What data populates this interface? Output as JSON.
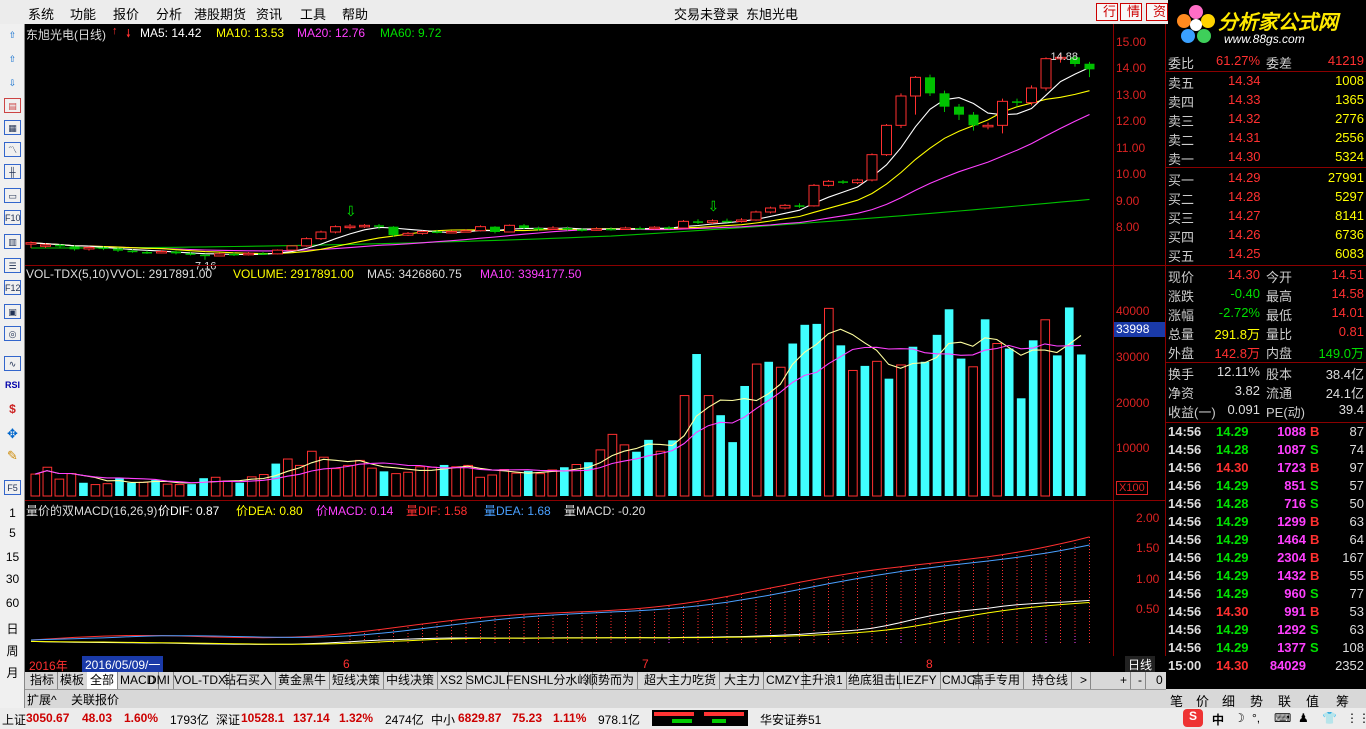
{
  "menu": {
    "items": [
      "系统",
      "功能",
      "报价",
      "分析",
      "港股期货",
      "资讯",
      "工具",
      "帮助"
    ],
    "login_status": "交易未登录",
    "stock_name": "东旭光电",
    "btn_quote": "行",
    "btn_info": "情",
    "btn_more": "资"
  },
  "logo": {
    "title": "分析家公式网",
    "url": "www.88gs.com"
  },
  "toolbar": {
    "period_labels": [
      "1",
      "5",
      "15",
      "30",
      "60",
      "日",
      "周",
      "月"
    ]
  },
  "kline": {
    "title": "东旭光电(日线)",
    "ma5": "MA5: 14.42",
    "ma10": "MA10: 13.53",
    "ma20": "MA20: 12.76",
    "ma60": "MA60: 9.72",
    "high_label": "14.88",
    "low_label": "7.16"
  },
  "volume": {
    "title": "VOL-TDX(5,10)",
    "vvol": "VVOL: 2917891.00",
    "volume": "VOLUME: 2917891.00",
    "ma5": "MA5: 3426860.75",
    "ma10": "MA10: 3394177.50",
    "marker": "33998",
    "scale": "X100"
  },
  "macd": {
    "title": "量价的双MACD(16,26,9)",
    "dif": "价DIF: 0.87",
    "dea": "价DEA: 0.80",
    "macd": "价MACD: 0.14",
    "vdif": "量DIF: 1.58",
    "vdea": "量DEA: 1.68",
    "vmacd": "量MACD: -0.20"
  },
  "axis": {
    "price": [
      "15.00",
      "14.00",
      "13.00",
      "12.00",
      "11.00",
      "10.00",
      "9.00",
      "8.00"
    ],
    "volume": [
      "40000",
      "30000",
      "20000",
      "10000"
    ],
    "macd": [
      "2.00",
      "1.50",
      "1.00",
      "0.50"
    ],
    "period": "日线"
  },
  "timeline": {
    "year": "2016年",
    "date": "2016/05/09/一",
    "months": [
      "6",
      "7",
      "8"
    ]
  },
  "tabs": [
    "指标",
    "模板",
    "全部",
    "MACD",
    "DMI",
    "VOL-TDX",
    "钻石买入",
    "黄金黑牛",
    "短线决策",
    "中线决策",
    "XS2",
    "SMCJL",
    "FENSHL分水岭",
    "顺势而为",
    "超大主力吃货",
    "大主力",
    "CMZY",
    "主升浪1",
    "绝底狙击",
    "LIEZFY",
    "CMJC",
    "高手专用",
    "持仓线",
    ">"
  ],
  "ext_tabs": [
    "扩展^",
    "关联报价"
  ],
  "quote": {
    "top": {
      "wb_label": "委比",
      "wb": "61.27%",
      "wc_label": "委差",
      "wc": "41219"
    },
    "sells": [
      {
        "label": "卖五",
        "price": "14.34",
        "vol": "1008"
      },
      {
        "label": "卖四",
        "price": "14.33",
        "vol": "1365"
      },
      {
        "label": "卖三",
        "price": "14.32",
        "vol": "2776"
      },
      {
        "label": "卖二",
        "price": "14.31",
        "vol": "2556"
      },
      {
        "label": "卖一",
        "price": "14.30",
        "vol": "5324"
      }
    ],
    "buys": [
      {
        "label": "买一",
        "price": "14.29",
        "vol": "27991"
      },
      {
        "label": "买二",
        "price": "14.28",
        "vol": "5297"
      },
      {
        "label": "买三",
        "price": "14.27",
        "vol": "8141"
      },
      {
        "label": "买四",
        "price": "14.26",
        "vol": "6736"
      },
      {
        "label": "买五",
        "price": "14.25",
        "vol": "6083"
      }
    ],
    "stats": [
      {
        "l1": "现价",
        "v1": "14.30",
        "l2": "今开",
        "v2": "14.51"
      },
      {
        "l1": "涨跌",
        "v1": "-0.40",
        "l2": "最高",
        "v2": "14.58"
      },
      {
        "l1": "涨幅",
        "v1": "-2.72%",
        "l2": "最低",
        "v2": "14.01"
      },
      {
        "l1": "总量",
        "v1": "291.8万",
        "l2": "量比",
        "v2": "0.81"
      },
      {
        "l1": "外盘",
        "v1": "142.8万",
        "l2": "内盘",
        "v2": "149.0万"
      }
    ],
    "stats2": [
      {
        "l1": "换手",
        "v1": "12.11%",
        "l2": "股本",
        "v2": "38.4亿"
      },
      {
        "l1": "净资",
        "v1": "3.82",
        "l2": "流通",
        "v2": "24.1亿"
      },
      {
        "l1": "收益(一)",
        "v1": "0.091",
        "l2": "PE(动)",
        "v2": "39.4"
      }
    ],
    "ticks": [
      {
        "t": "14:56",
        "p": "14.29",
        "v": "1088",
        "bs": "B",
        "n": "87"
      },
      {
        "t": "14:56",
        "p": "14.28",
        "v": "1087",
        "bs": "S",
        "n": "74"
      },
      {
        "t": "14:56",
        "p": "14.30",
        "v": "1723",
        "bs": "B",
        "n": "97"
      },
      {
        "t": "14:56",
        "p": "14.29",
        "v": "851",
        "bs": "S",
        "n": "57"
      },
      {
        "t": "14:56",
        "p": "14.28",
        "v": "716",
        "bs": "S",
        "n": "50"
      },
      {
        "t": "14:56",
        "p": "14.29",
        "v": "1299",
        "bs": "B",
        "n": "63"
      },
      {
        "t": "14:56",
        "p": "14.29",
        "v": "1464",
        "bs": "B",
        "n": "64"
      },
      {
        "t": "14:56",
        "p": "14.29",
        "v": "2304",
        "bs": "B",
        "n": "167"
      },
      {
        "t": "14:56",
        "p": "14.29",
        "v": "1432",
        "bs": "B",
        "n": "55"
      },
      {
        "t": "14:56",
        "p": "14.29",
        "v": "960",
        "bs": "S",
        "n": "77"
      },
      {
        "t": "14:56",
        "p": "14.30",
        "v": "991",
        "bs": "B",
        "n": "53"
      },
      {
        "t": "14:56",
        "p": "14.29",
        "v": "1292",
        "bs": "S",
        "n": "63"
      },
      {
        "t": "14:56",
        "p": "14.29",
        "v": "1377",
        "bs": "S",
        "n": "108"
      },
      {
        "t": "15:00",
        "p": "14.30",
        "v": "84029",
        "bs": "",
        "n": "2352"
      }
    ],
    "code_hint": "000413"
  },
  "right_tabs": [
    "笔",
    "价",
    "细",
    "势",
    "联",
    "值",
    "筹"
  ],
  "status": {
    "sh_label": "上证",
    "sh": "3050.67",
    "sh_chg": "48.03",
    "sh_pct": "1.60%",
    "sh_amt": "1793亿",
    "sz_label": "深证",
    "sz": "10528.1",
    "sz_chg": "137.14",
    "sz_pct": "1.32%",
    "sz_amt": "2474亿",
    "zx_label": "中小",
    "zx": "6829.87",
    "zx_chg": "75.23",
    "zx_pct": "1.11%",
    "zx_amt": "978.1亿",
    "broker": "华安证券51",
    "ime": "中"
  },
  "chart_data": {
    "type": "candlestick",
    "price_ylim": [
      7.0,
      15.4
    ],
    "candles": [
      [
        7.75,
        7.8,
        7.6,
        7.85
      ],
      [
        7.7,
        7.72,
        7.6,
        7.78
      ],
      [
        7.72,
        7.66,
        7.62,
        7.75
      ],
      [
        7.66,
        7.55,
        7.5,
        7.7
      ],
      [
        7.6,
        7.62,
        7.5,
        7.66
      ],
      [
        7.62,
        7.58,
        7.52,
        7.66
      ],
      [
        7.58,
        7.5,
        7.45,
        7.62
      ],
      [
        7.5,
        7.45,
        7.42,
        7.55
      ],
      [
        7.45,
        7.42,
        7.38,
        7.5
      ],
      [
        7.42,
        7.47,
        7.4,
        7.52
      ],
      [
        7.47,
        7.4,
        7.36,
        7.5
      ],
      [
        7.4,
        7.35,
        7.32,
        7.45
      ],
      [
        7.35,
        7.3,
        7.16,
        7.38
      ],
      [
        7.3,
        7.38,
        7.28,
        7.42
      ],
      [
        7.38,
        7.35,
        7.3,
        7.45
      ],
      [
        7.35,
        7.4,
        7.32,
        7.45
      ],
      [
        7.4,
        7.38,
        7.34,
        7.45
      ],
      [
        7.38,
        7.52,
        7.36,
        7.55
      ],
      [
        7.52,
        7.68,
        7.5,
        7.7
      ],
      [
        7.68,
        7.95,
        7.65,
        8.0
      ],
      [
        7.95,
        8.2,
        7.9,
        8.25
      ],
      [
        8.2,
        8.4,
        8.15,
        8.45
      ],
      [
        8.4,
        8.42,
        8.3,
        8.5
      ],
      [
        8.42,
        8.45,
        8.35,
        8.5
      ],
      [
        8.45,
        8.4,
        8.3,
        8.5
      ],
      [
        8.4,
        8.08,
        8.02,
        8.42
      ],
      [
        8.08,
        8.15,
        8.05,
        8.2
      ],
      [
        8.15,
        8.22,
        8.1,
        8.25
      ],
      [
        8.22,
        8.2,
        8.15,
        8.28
      ],
      [
        8.2,
        8.22,
        8.15,
        8.25
      ],
      [
        8.22,
        8.25,
        8.18,
        8.3
      ],
      [
        8.25,
        8.4,
        8.22,
        8.45
      ],
      [
        8.4,
        8.2,
        8.15,
        8.42
      ],
      [
        8.2,
        8.45,
        8.18,
        8.48
      ],
      [
        8.45,
        8.35,
        8.3,
        8.5
      ],
      [
        8.35,
        8.3,
        8.25,
        8.4
      ],
      [
        8.3,
        8.35,
        8.28,
        8.42
      ],
      [
        8.35,
        8.3,
        8.25,
        8.4
      ],
      [
        8.3,
        8.28,
        8.22,
        8.35
      ],
      [
        8.28,
        8.32,
        8.25,
        8.38
      ],
      [
        8.32,
        8.3,
        8.25,
        8.38
      ],
      [
        8.3,
        8.35,
        8.28,
        8.4
      ],
      [
        8.35,
        8.33,
        8.28,
        8.4
      ],
      [
        8.33,
        8.38,
        8.3,
        8.42
      ],
      [
        8.38,
        8.35,
        8.3,
        8.42
      ],
      [
        8.35,
        8.6,
        8.33,
        8.65
      ],
      [
        8.6,
        8.55,
        8.5,
        8.68
      ],
      [
        8.55,
        8.62,
        8.5,
        8.68
      ],
      [
        8.62,
        8.6,
        8.55,
        8.7
      ],
      [
        8.6,
        8.65,
        8.55,
        8.72
      ],
      [
        8.65,
        8.95,
        8.62,
        9.0
      ],
      [
        8.95,
        9.1,
        8.9,
        9.15
      ],
      [
        9.1,
        9.2,
        9.05,
        9.25
      ],
      [
        9.2,
        9.18,
        9.1,
        9.28
      ],
      [
        9.18,
        9.95,
        9.15,
        10.0
      ],
      [
        9.95,
        10.1,
        9.9,
        10.15
      ],
      [
        10.1,
        10.05,
        10.0,
        10.15
      ],
      [
        10.05,
        10.15,
        10.0,
        10.2
      ],
      [
        10.15,
        11.1,
        10.1,
        11.15
      ],
      [
        11.1,
        12.2,
        11.05,
        12.25
      ],
      [
        12.2,
        13.3,
        12.1,
        13.4
      ],
      [
        13.3,
        14.0,
        12.6,
        14.05
      ],
      [
        14.0,
        13.4,
        13.3,
        14.1
      ],
      [
        13.4,
        12.9,
        12.7,
        13.5
      ],
      [
        12.9,
        12.6,
        12.4,
        13.0
      ],
      [
        12.6,
        12.2,
        12.0,
        12.7
      ],
      [
        12.2,
        12.2,
        12.05,
        12.3
      ],
      [
        12.2,
        13.1,
        11.9,
        13.2
      ],
      [
        13.1,
        13.05,
        12.9,
        13.2
      ],
      [
        13.05,
        13.6,
        12.95,
        13.7
      ],
      [
        13.6,
        14.7,
        13.5,
        14.75
      ],
      [
        14.7,
        14.75,
        14.55,
        14.88
      ],
      [
        14.75,
        14.5,
        14.4,
        14.8
      ],
      [
        14.51,
        14.3,
        14.01,
        14.58
      ]
    ],
    "volume_ylim": [
      0,
      46000
    ],
    "volumes": [
      4800,
      6300,
      3700,
      4900,
      2900,
      2500,
      2700,
      3900,
      2900,
      3000,
      3500,
      2600,
      2500,
      2600,
      3900,
      4100,
      3300,
      2900,
      4200,
      4700,
      7100,
      8100,
      6700,
      9800,
      8500,
      6000,
      6700,
      7800,
      6100,
      5400,
      4900,
      5200,
      6400,
      6300,
      6800,
      6400,
      6700,
      4100,
      4600,
      5800,
      5000,
      5500,
      4900,
      5700,
      6300,
      6900,
      7400,
      10100,
      13500,
      11200,
      9700,
      12300,
      9800,
      12200,
      22000,
      31100,
      22000,
      17700,
      11800,
      24100,
      28900,
      29400,
      28200,
      33400,
      37500,
      37700,
      41100,
      33000,
      27500,
      28500,
      29500,
      25700,
      28700,
      32700,
      29400,
      35300,
      40900,
      30100,
      28300,
      38700,
      33400,
      32300,
      21400,
      34100,
      38600,
      30800,
      41300,
      31000
    ],
    "macd_ylim": [
      -0.15,
      2.15
    ]
  }
}
